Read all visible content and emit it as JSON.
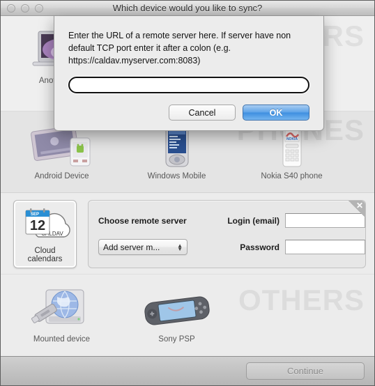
{
  "window": {
    "title": "Which device would you like to sync?",
    "traffic_lights": [
      "close",
      "minimize",
      "zoom"
    ]
  },
  "sections": {
    "computers": {
      "watermark": "COMPUTERS",
      "devices": [
        {
          "label": "Another Mac",
          "icon": "macbook-icon"
        }
      ]
    },
    "phones": {
      "watermark": "PHONES",
      "devices": [
        {
          "label": "Android Device",
          "icon": "android-tablet-phone-icon"
        },
        {
          "label": "Windows Mobile",
          "icon": "windows-mobile-icon"
        },
        {
          "label": "Nokia S40 phone",
          "icon": "nokia-phone-icon"
        }
      ]
    },
    "cloud": {
      "tile": {
        "label": "Cloud calendars",
        "icon": "caldav-cloud-calendar-icon",
        "calendar_month": "SEP",
        "calendar_day": "12",
        "cloud_text": "CALDAV"
      },
      "panel": {
        "close_icon": "close-icon",
        "choose_server_label": "Choose remote server",
        "server_select_value": "Add server m...",
        "login_label": "Login (email)",
        "login_value": "",
        "login_placeholder": "",
        "password_label": "Password",
        "password_value": "",
        "password_placeholder": ""
      }
    },
    "others": {
      "watermark": "OTHERS",
      "devices": [
        {
          "label": "Mounted device",
          "icon": "mounted-drive-icon"
        },
        {
          "label": "Sony PSP",
          "icon": "sony-psp-icon"
        }
      ]
    }
  },
  "footer": {
    "continue_label": "Continue",
    "continue_enabled": false
  },
  "modal": {
    "message": "Enter the URL of a remote server here. If server have non default TCP port enter it after a colon (e.g. https://caldav.myserver.com:8083)",
    "input_value": "",
    "input_placeholder": "",
    "cancel_label": "Cancel",
    "ok_label": "OK"
  },
  "colors": {
    "accent_blue": "#3e8fe0",
    "window_bg": "#ececec",
    "phones_bg": "#e4e4e4",
    "watermark": "rgba(0,0,0,0.065)"
  }
}
